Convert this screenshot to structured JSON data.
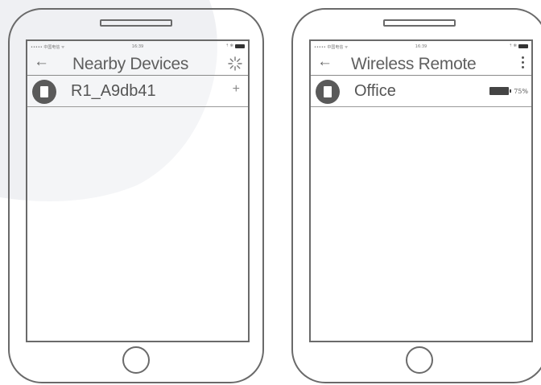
{
  "left_phone": {
    "status": {
      "carrier": "••••• 中国电信 ᯤ",
      "time": "16:39",
      "indicators": "⇡ ✻"
    },
    "header": {
      "back_icon": "←",
      "title": "Nearby Devices",
      "action_icon": "loading-spinner-icon"
    },
    "devices": [
      {
        "name": "R1_A9db41",
        "action": "+"
      }
    ]
  },
  "right_phone": {
    "status": {
      "carrier": "••••• 中国电信 ᯤ",
      "time": "16:39",
      "indicators": "⇡ ✻"
    },
    "header": {
      "back_icon": "←",
      "title": "Wireless Remote",
      "action_icon": "more-vertical-icon"
    },
    "devices": [
      {
        "name": "Office",
        "battery": "75%"
      }
    ]
  },
  "colors": {
    "outline": "#6a6a6a",
    "background_arc": "#f0f1f4"
  }
}
